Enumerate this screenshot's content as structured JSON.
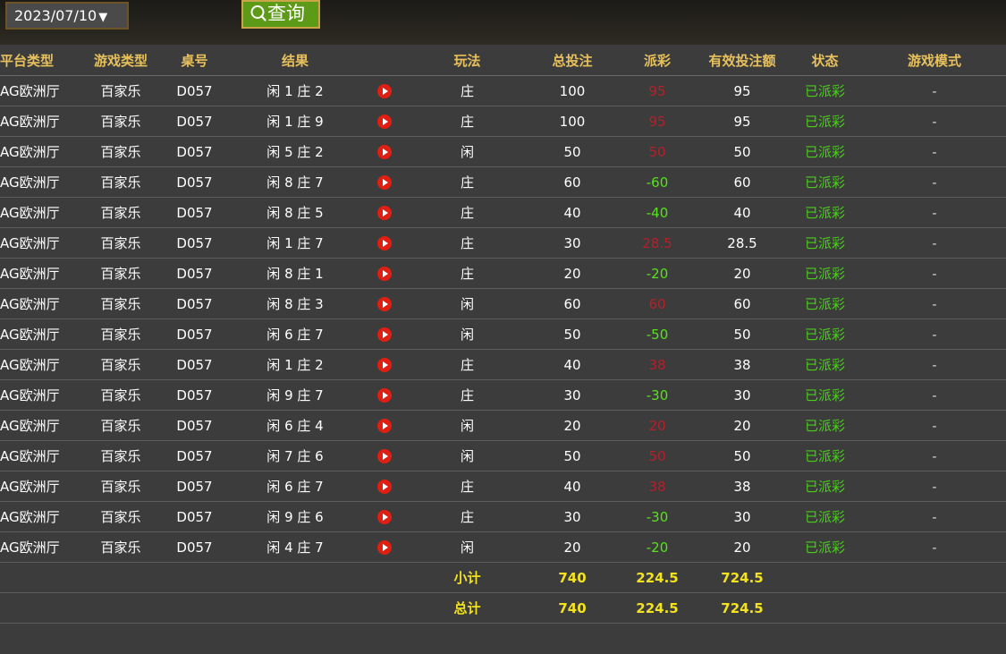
{
  "toolbar": {
    "date_value": "2023/07/10",
    "date_caret": "▼",
    "query_label": "查询",
    "query_icon": "search-icon",
    "query_color": "#5c9a17"
  },
  "table": {
    "headers": [
      "平台类型",
      "游戏类型",
      "桌号",
      "结果",
      "",
      "玩法",
      "总投注",
      "派彩",
      "有效投注额",
      "状态",
      "游戏模式"
    ],
    "rows": [
      {
        "platform": "AG欧洲厅",
        "game": "百家乐",
        "table": "D057",
        "result": "闲 1 庄 2",
        "play": "庄",
        "bet": "100",
        "payout": "95",
        "valid": "95",
        "status": "已派彩",
        "mode": "-",
        "payout_color": "#b5202a"
      },
      {
        "platform": "AG欧洲厅",
        "game": "百家乐",
        "table": "D057",
        "result": "闲 1 庄 9",
        "play": "庄",
        "bet": "100",
        "payout": "95",
        "valid": "95",
        "status": "已派彩",
        "mode": "-",
        "payout_color": "#b5202a"
      },
      {
        "platform": "AG欧洲厅",
        "game": "百家乐",
        "table": "D057",
        "result": "闲 5 庄 2",
        "play": "闲",
        "bet": "50",
        "payout": "50",
        "valid": "50",
        "status": "已派彩",
        "mode": "-",
        "payout_color": "#b5202a"
      },
      {
        "platform": "AG欧洲厅",
        "game": "百家乐",
        "table": "D057",
        "result": "闲 8 庄 7",
        "play": "庄",
        "bet": "60",
        "payout": "-60",
        "valid": "60",
        "status": "已派彩",
        "mode": "-",
        "payout_color": "#56e31a"
      },
      {
        "platform": "AG欧洲厅",
        "game": "百家乐",
        "table": "D057",
        "result": "闲 8 庄 5",
        "play": "庄",
        "bet": "40",
        "payout": "-40",
        "valid": "40",
        "status": "已派彩",
        "mode": "-",
        "payout_color": "#56e31a"
      },
      {
        "platform": "AG欧洲厅",
        "game": "百家乐",
        "table": "D057",
        "result": "闲 1 庄 7",
        "play": "庄",
        "bet": "30",
        "payout": "28.5",
        "valid": "28.5",
        "status": "已派彩",
        "mode": "-",
        "payout_color": "#b5202a"
      },
      {
        "platform": "AG欧洲厅",
        "game": "百家乐",
        "table": "D057",
        "result": "闲 8 庄 1",
        "play": "庄",
        "bet": "20",
        "payout": "-20",
        "valid": "20",
        "status": "已派彩",
        "mode": "-",
        "payout_color": "#56e31a"
      },
      {
        "platform": "AG欧洲厅",
        "game": "百家乐",
        "table": "D057",
        "result": "闲 8 庄 3",
        "play": "闲",
        "bet": "60",
        "payout": "60",
        "valid": "60",
        "status": "已派彩",
        "mode": "-",
        "payout_color": "#b5202a"
      },
      {
        "platform": "AG欧洲厅",
        "game": "百家乐",
        "table": "D057",
        "result": "闲 6 庄 7",
        "play": "闲",
        "bet": "50",
        "payout": "-50",
        "valid": "50",
        "status": "已派彩",
        "mode": "-",
        "payout_color": "#56e31a"
      },
      {
        "platform": "AG欧洲厅",
        "game": "百家乐",
        "table": "D057",
        "result": "闲 1 庄 2",
        "play": "庄",
        "bet": "40",
        "payout": "38",
        "valid": "38",
        "status": "已派彩",
        "mode": "-",
        "payout_color": "#b5202a"
      },
      {
        "platform": "AG欧洲厅",
        "game": "百家乐",
        "table": "D057",
        "result": "闲 9 庄 7",
        "play": "庄",
        "bet": "30",
        "payout": "-30",
        "valid": "30",
        "status": "已派彩",
        "mode": "-",
        "payout_color": "#56e31a"
      },
      {
        "platform": "AG欧洲厅",
        "game": "百家乐",
        "table": "D057",
        "result": "闲 6 庄 4",
        "play": "闲",
        "bet": "20",
        "payout": "20",
        "valid": "20",
        "status": "已派彩",
        "mode": "-",
        "payout_color": "#b5202a"
      },
      {
        "platform": "AG欧洲厅",
        "game": "百家乐",
        "table": "D057",
        "result": "闲 7 庄 6",
        "play": "闲",
        "bet": "50",
        "payout": "50",
        "valid": "50",
        "status": "已派彩",
        "mode": "-",
        "payout_color": "#b5202a"
      },
      {
        "platform": "AG欧洲厅",
        "game": "百家乐",
        "table": "D057",
        "result": "闲 6 庄 7",
        "play": "庄",
        "bet": "40",
        "payout": "38",
        "valid": "38",
        "status": "已派彩",
        "mode": "-",
        "payout_color": "#b5202a"
      },
      {
        "platform": "AG欧洲厅",
        "game": "百家乐",
        "table": "D057",
        "result": "闲 9 庄 6",
        "play": "庄",
        "bet": "30",
        "payout": "-30",
        "valid": "30",
        "status": "已派彩",
        "mode": "-",
        "payout_color": "#56e31a"
      },
      {
        "platform": "AG欧洲厅",
        "game": "百家乐",
        "table": "D057",
        "result": "闲 4 庄 7",
        "play": "闲",
        "bet": "20",
        "payout": "-20",
        "valid": "20",
        "status": "已派彩",
        "mode": "-",
        "payout_color": "#56e31a"
      }
    ],
    "subtotal": {
      "label": "小计",
      "bet": "740",
      "payout": "224.5",
      "valid": "724.5"
    },
    "total": {
      "label": "总计",
      "bet": "740",
      "payout": "224.5",
      "valid": "724.5"
    }
  },
  "colors": {
    "header_text": "#e8c15c",
    "payout_win": "#b5202a",
    "payout_loss": "#56e31a",
    "status": "#47cf18",
    "summary": "#f2e21f",
    "play_icon": "#e01f12"
  }
}
